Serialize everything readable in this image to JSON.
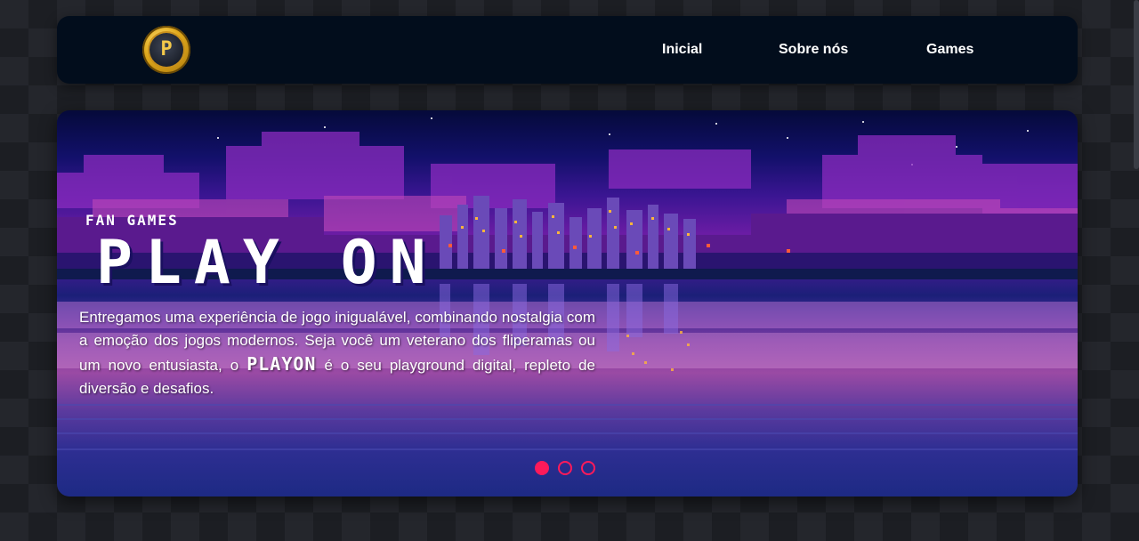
{
  "nav": {
    "logo_letter": "P",
    "links": [
      "Inicial",
      "Sobre nós",
      "Games"
    ]
  },
  "hero": {
    "eyebrow": "FAN GAMES",
    "title": "PLAY ON",
    "desc_part1": "Entregamos uma experiência de jogo inigualável, combinando nostalgia com a emoção dos jogos modernos. Seja você um veterano dos fliperamas ou um novo entusiasta, o ",
    "desc_brand": "PLAYON",
    "desc_part2": " é o seu playground digital, repleto de diversão e desafios.",
    "slides_total": 3,
    "slide_active": 1
  },
  "colors": {
    "accent": "#ff1a5a",
    "nav_bg": "#020d1c",
    "logo_gold": "#e0a91c"
  }
}
